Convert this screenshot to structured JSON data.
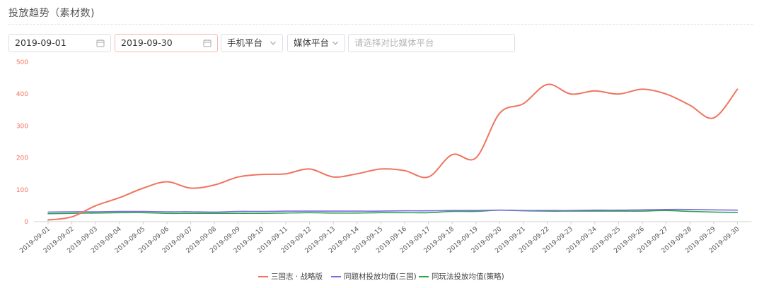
{
  "page": {
    "title": "投放趋势（素材数)"
  },
  "filters": {
    "start_date": "2019-09-01",
    "end_date": "2019-09-30",
    "platform": "手机平台",
    "media": "媒体平台",
    "compare_placeholder": "请选择对比媒体平台"
  },
  "colors": {
    "series_1": "#f0735e",
    "series_2": "#7b6be0",
    "series_3": "#2ea44f",
    "axis_label": "#f0735e",
    "axis_line": "#d0d0d0"
  },
  "icons": {
    "date": "calendar-icon",
    "select": "chevron-down-icon"
  },
  "chart_data": {
    "type": "line",
    "title": "",
    "xlabel": "",
    "ylabel": "",
    "ylim": [
      0,
      500
    ],
    "yticks": [
      0,
      100,
      200,
      300,
      400,
      500
    ],
    "grid": false,
    "legend_position": "bottom-center",
    "categories": [
      "2019-09-01",
      "2019-09-02",
      "2019-09-03",
      "2019-09-04",
      "2019-09-05",
      "2019-09-06",
      "2019-09-07",
      "2019-09-08",
      "2019-09-09",
      "2019-09-10",
      "2019-09-11",
      "2019-09-12",
      "2019-09-13",
      "2019-09-14",
      "2019-09-15",
      "2019-09-16",
      "2019-09-17",
      "2019-09-18",
      "2019-09-19",
      "2019-09-20",
      "2019-09-21",
      "2019-09-22",
      "2019-09-23",
      "2019-09-24",
      "2019-09-25",
      "2019-09-26",
      "2019-09-27",
      "2019-09-28",
      "2019-09-29",
      "2019-09-30"
    ],
    "series": [
      {
        "name": "三国志 · 战略版",
        "values": [
          5,
          15,
          50,
          75,
          105,
          125,
          105,
          115,
          140,
          148,
          150,
          165,
          140,
          150,
          165,
          160,
          140,
          210,
          200,
          340,
          370,
          430,
          400,
          410,
          400,
          415,
          400,
          365,
          325,
          415
        ]
      },
      {
        "name": "同题材投放均值(三国)",
        "values": [
          30,
          31,
          31,
          32,
          32,
          31,
          31,
          30,
          32,
          32,
          33,
          33,
          33,
          33,
          33,
          34,
          34,
          35,
          35,
          36,
          35,
          35,
          35,
          36,
          36,
          37,
          38,
          38,
          37,
          36
        ]
      },
      {
        "name": "同玩法投放均值(策略)",
        "values": [
          25,
          26,
          27,
          28,
          28,
          26,
          26,
          26,
          26,
          26,
          27,
          28,
          27,
          27,
          28,
          28,
          28,
          32,
          32,
          36,
          34,
          33,
          33,
          33,
          33,
          33,
          35,
          32,
          30,
          29
        ]
      }
    ]
  }
}
